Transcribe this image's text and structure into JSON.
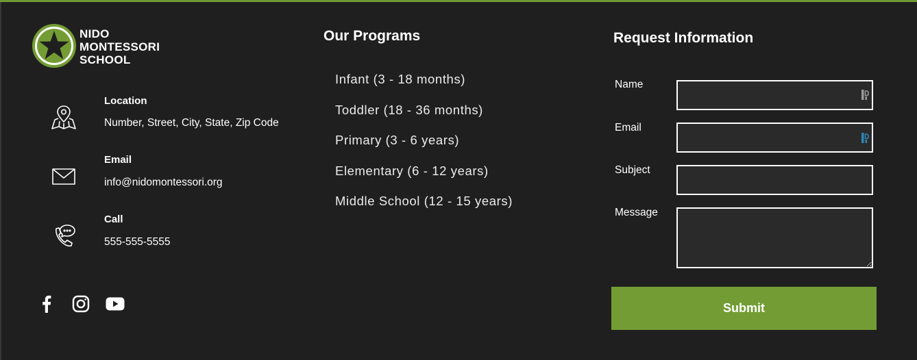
{
  "colors": {
    "background": "#1f1f1f",
    "accent": "#739d34",
    "text": "#ffffff"
  },
  "logo": {
    "icon": "star-logo-icon",
    "lines": [
      "NIDO",
      "MONTESSORI",
      "SCHOOL"
    ]
  },
  "contact": {
    "location": {
      "icon": "map-pin-icon",
      "title": "Location",
      "value": "Number, Street, City, State, Zip Code"
    },
    "email": {
      "icon": "envelope-icon",
      "title": "Email",
      "value": "info@nidomontessori.org"
    },
    "call": {
      "icon": "phone-chat-icon",
      "title": "Call",
      "value": "555-555-5555"
    }
  },
  "social": [
    "facebook-icon",
    "instagram-icon",
    "youtube-icon"
  ],
  "programs": {
    "title": "Our Programs",
    "items": [
      "Infant (3 - 18 months)",
      "Toddler (18 - 36 months)",
      "Primary (3 - 6 years)",
      "Elementary (6 - 12 years)",
      "Middle School (12 - 15 years)"
    ]
  },
  "form": {
    "title": "Request Information",
    "name_label": "Name",
    "name_value": "",
    "email_label": "Email",
    "email_value": "",
    "subject_label": "Subject",
    "subject_value": "",
    "message_label": "Message",
    "message_value": "",
    "submit_label": "Submit"
  }
}
